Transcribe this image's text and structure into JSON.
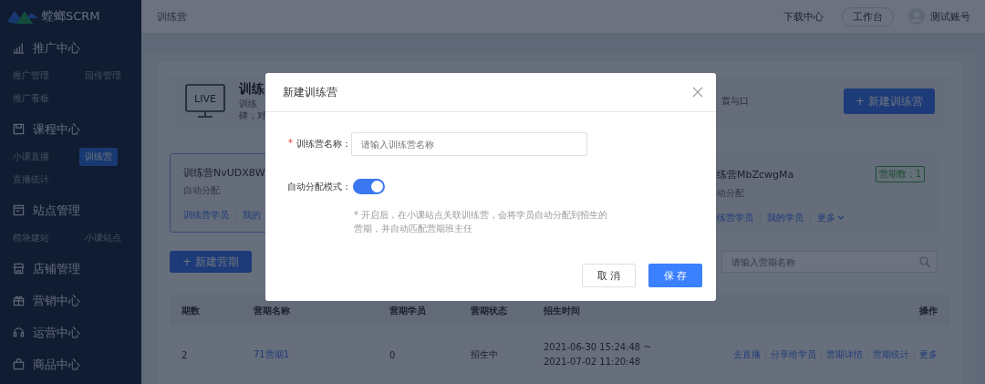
{
  "sidebar": {
    "logo": "螳螂SCRM",
    "sections": [
      {
        "label": "推广中心",
        "children": [
          {
            "label": "推广管理",
            "selected": false
          },
          {
            "label": "回传管理",
            "selected": false
          },
          {
            "label": "推广看板",
            "selected": false
          }
        ]
      },
      {
        "label": "课程中心",
        "children": [
          {
            "label": "小课直播",
            "selected": false
          },
          {
            "label": "训练营",
            "selected": true
          },
          {
            "label": "直播统计",
            "selected": false
          }
        ]
      },
      {
        "label": "站点管理",
        "children": [
          {
            "label": "模块建站",
            "selected": false
          },
          {
            "label": "小课站点",
            "selected": false
          }
        ]
      },
      {
        "label": "店铺管理"
      },
      {
        "label": "营销中心"
      },
      {
        "label": "运营中心"
      },
      {
        "label": "商品中心"
      }
    ]
  },
  "header": {
    "breadcrumb": "训练营",
    "download_link": "下载中心",
    "workbench_button": "工作台",
    "account": "测试账号"
  },
  "hero": {
    "icon_label": "LIVE",
    "title": "训练",
    "description": [
      "训练",
      "碑，对"
    ],
    "description_tail": "置与口",
    "create_button": "+ 新建训练营"
  },
  "camps": [
    {
      "title": "训练营NvUDX8W",
      "mode": "自动分配",
      "links": [
        "训练营学员",
        "我的"
      ],
      "selected": true
    },
    {
      "title": "练营MbZcwgMa",
      "mode": "动分配",
      "links": [
        "练营学员",
        "我的学员",
        "更多"
      ],
      "badge": "营期数：1",
      "selected": false
    }
  ],
  "toolbar": {
    "create_button": "+ 新建营期",
    "search": {
      "placeholder": "请输入营期名称"
    }
  },
  "table": {
    "columns": [
      "期数",
      "营期名称",
      "营期学员",
      "营期状态",
      "招生时间",
      "操作"
    ],
    "rows": [
      {
        "number": "2",
        "name": "71营期1",
        "students": "0",
        "status": "招生中",
        "time": [
          "2021-06-30 15:24:48 ~",
          "2021-07-02 11:20:48"
        ],
        "actions": [
          "去直播",
          "分享给学员",
          "营期详情",
          "营期统计",
          "更多"
        ]
      }
    ]
  },
  "dialog": {
    "title": "新建训练营",
    "fields": [
      {
        "kind": "text",
        "required_mark": "*",
        "label": "训练营名称：",
        "placeholder": "请输入训练营名称"
      },
      {
        "kind": "toggle",
        "label": "自动分配模式：",
        "on": true,
        "hint": [
          "* 开启后，在小课站点关联训练营，会将学员自动分配到招生的",
          "营期，并自动匹配营期班主任"
        ]
      }
    ],
    "buttons": [
      {
        "label": "取 消",
        "kind": "default"
      },
      {
        "label": "保 存",
        "kind": "primary"
      }
    ]
  }
}
